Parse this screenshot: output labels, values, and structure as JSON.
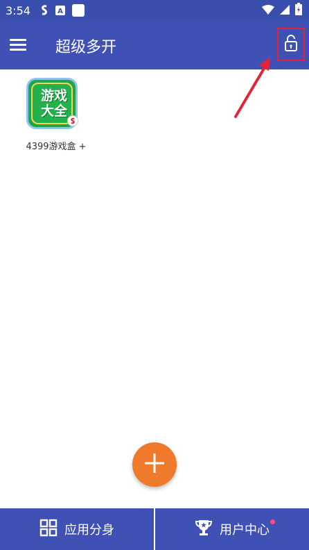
{
  "status_bar": {
    "time": "3:54",
    "icons": [
      "s-app-icon",
      "a-app-icon",
      "square-app-icon",
      "wifi-icon",
      "signal-icon",
      "battery-charging-icon"
    ]
  },
  "toolbar": {
    "title": "超级多开",
    "menu_icon": "hamburger-menu-icon",
    "lock_icon": "lock-icon"
  },
  "apps": [
    {
      "label": "4399游戏盒 +",
      "icon_text": "游戏大全",
      "icon": "app-icon-4399"
    }
  ],
  "fab": {
    "icon": "plus-icon"
  },
  "bottom_nav": {
    "tabs": [
      {
        "label": "应用分身",
        "icon": "grid-icon"
      },
      {
        "label": "用户中心",
        "icon": "trophy-icon",
        "notification": true
      }
    ]
  },
  "colors": {
    "primary": "#3f51b5",
    "status_bar": "#3a4fad",
    "accent": "#f07a2c",
    "annotation": "#e5223a",
    "notification_dot": "#ff4a7d"
  }
}
